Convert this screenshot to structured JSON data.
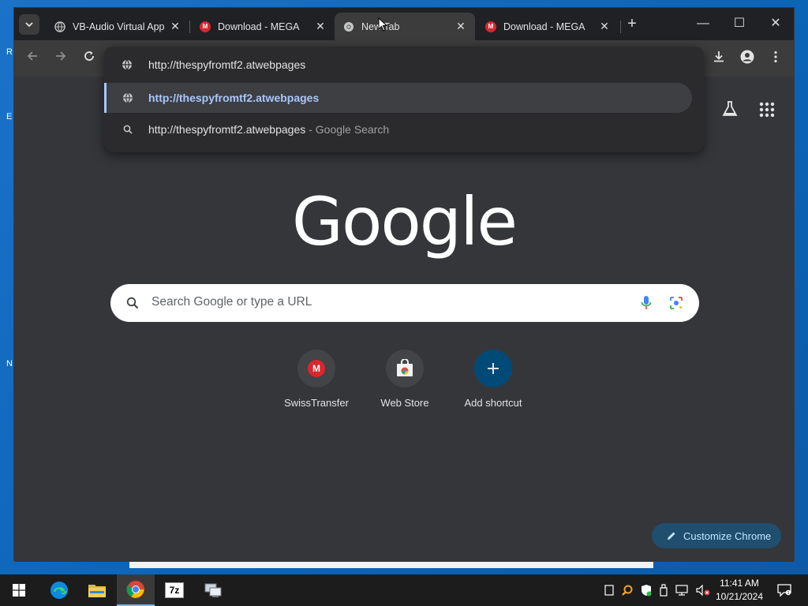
{
  "tabs": [
    {
      "title": "VB-Audio Virtual App",
      "icon": "globe-icon",
      "active": false
    },
    {
      "title": "Download - MEGA",
      "icon": "mega-icon",
      "active": false
    },
    {
      "title": "New Tab",
      "icon": "chrome-icon",
      "active": true
    },
    {
      "title": "Download - MEGA",
      "icon": "mega-icon",
      "active": false
    }
  ],
  "tab_close": "✕",
  "new_tab_button": "+",
  "window_controls": {
    "minimize": "—",
    "maximize": "☐",
    "close": "✕"
  },
  "omnibox": {
    "input_value": "http://thespyfromtf2.atwebpages",
    "suggestions": [
      {
        "text": "http://thespyfromtf2.atwebpages",
        "suffix": "",
        "icon": "globe-icon",
        "selected": true
      },
      {
        "text": "http://thespyfromtf2.atwebpages",
        "suffix": "- Google Search",
        "icon": "search-icon",
        "selected": false
      }
    ]
  },
  "logo_text": "Google",
  "search": {
    "placeholder": "Search Google or type a URL"
  },
  "shortcuts": [
    {
      "label": "SwissTransfer",
      "icon": "mega-icon"
    },
    {
      "label": "Web Store",
      "icon": "web-store-icon"
    },
    {
      "label": "Add shortcut",
      "icon": "plus-icon"
    }
  ],
  "customize_label": "Customize Chrome",
  "taskbar": {
    "apps": [
      "start-icon",
      "edge-icon",
      "file-explorer-icon",
      "chrome-icon",
      "7zip-icon",
      "network-app-icon"
    ],
    "time": "11:41 AM",
    "date": "10/21/2024"
  },
  "colors": {
    "accent": "#a8c7fa",
    "toolbar": "#3c3c3c",
    "content": "#35363a",
    "mega_red": "#d9272e",
    "customize_bg": "#1f4e6e"
  }
}
